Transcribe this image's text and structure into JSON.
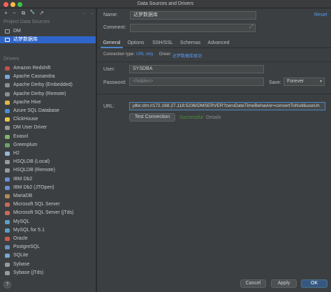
{
  "window": {
    "title": "Data Sources and Drivers",
    "traffic_colors": [
      "#fc605c",
      "#fdbc40",
      "#34c84a"
    ]
  },
  "toolbar": {
    "add": "+",
    "remove": "−",
    "copy": "⧉",
    "settings": "🔧",
    "export": "↗",
    "back": "←",
    "forward": "→"
  },
  "sidebar": {
    "project_header": "Project Data Sources",
    "project_items": [
      {
        "label": "DM"
      },
      {
        "label": "达梦数据库"
      }
    ],
    "drivers_header": "Drivers",
    "drivers": [
      {
        "label": "Amazon Redshift",
        "color": "#c0504d"
      },
      {
        "label": "Apache Cassandra",
        "color": "#7aa7d6"
      },
      {
        "label": "Apache Derby (Embedded)",
        "color": "#8e8e8e"
      },
      {
        "label": "Apache Derby (Remote)",
        "color": "#8e8e8e"
      },
      {
        "label": "Apache Hive",
        "color": "#e0b84a"
      },
      {
        "label": "Azure SQL Database",
        "color": "#4a8fd6"
      },
      {
        "label": "ClickHouse",
        "color": "#e6c84a"
      },
      {
        "label": "DM User Driver",
        "color": "#9a9a9a"
      },
      {
        "label": "Exasol",
        "color": "#7fb36a"
      },
      {
        "label": "Greenplum",
        "color": "#6aa26a"
      },
      {
        "label": "H2",
        "color": "#9ab4d8"
      },
      {
        "label": "HSQLDB (Local)",
        "color": "#9a9a9a"
      },
      {
        "label": "HSQLDB (Remote)",
        "color": "#9a9a9a"
      },
      {
        "label": "IBM Db2",
        "color": "#6b8fcf"
      },
      {
        "label": "IBM Db2 (JTOpen)",
        "color": "#6b8fcf"
      },
      {
        "label": "MariaDB",
        "color": "#b08a5a"
      },
      {
        "label": "Microsoft SQL Server",
        "color": "#c96b5a"
      },
      {
        "label": "Microsoft SQL Server (jTds)",
        "color": "#c96b5a"
      },
      {
        "label": "MySQL",
        "color": "#5f9ec7"
      },
      {
        "label": "MySQL for 5.1",
        "color": "#5f9ec7"
      },
      {
        "label": "Oracle",
        "color": "#d05a4a"
      },
      {
        "label": "PostgreSQL",
        "color": "#6a8fc0"
      },
      {
        "label": "SQLite",
        "color": "#7aa7d6"
      },
      {
        "label": "Sybase",
        "color": "#9a9a9a"
      },
      {
        "label": "Sybase (jTds)",
        "color": "#9a9a9a"
      }
    ]
  },
  "form": {
    "name_label": "Name:",
    "name_value": "达梦数据库",
    "reset": "Reset",
    "comment_label": "Comment:",
    "comment_value": "",
    "tabs": [
      "General",
      "Options",
      "SSH/SSL",
      "Schemas",
      "Advanced"
    ],
    "connection_type_label": "Connection type:",
    "connection_type_value": "URL only",
    "driver_label": "Driver:",
    "driver_value": "达梦数据库驱动",
    "user_label": "User:",
    "user_value": "SYSDBA",
    "password_label": "Password:",
    "password_placeholder": "<hidden>",
    "save_label": "Save:",
    "save_value": "Forever",
    "url_label": "URL:",
    "url_value": "jdbc:dm://172.168.27.118:5236/DMSERVER?zeroDateTimeBehavior=convertToNull&useUn",
    "test_button": "Test Connection",
    "test_status": "Successful",
    "details": "Details"
  },
  "footer": {
    "help": "?",
    "cancel": "Cancel",
    "apply": "Apply",
    "ok": "OK"
  }
}
